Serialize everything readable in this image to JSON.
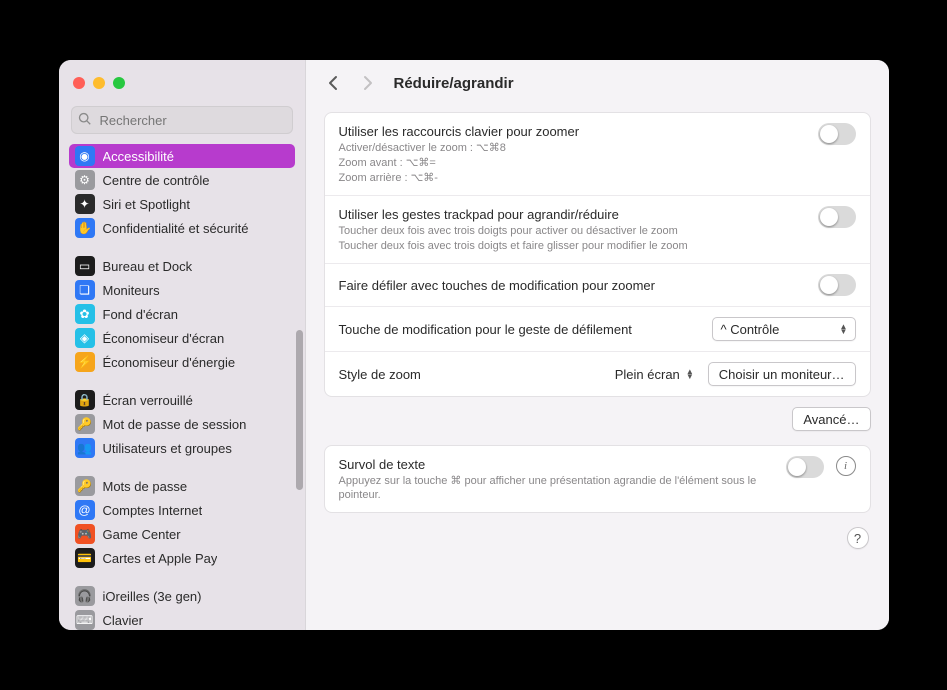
{
  "search": {
    "placeholder": "Rechercher"
  },
  "sidebar": {
    "items": [
      {
        "label": "Accessibilité",
        "color": "#2f78f5",
        "glyph": "◉"
      },
      {
        "label": "Centre de contrôle",
        "color": "#9a9a9e",
        "glyph": "⚙"
      },
      {
        "label": "Siri et Spotlight",
        "color": "#2a2a2a",
        "glyph": "✦"
      },
      {
        "label": "Confidentialité et sécurité",
        "color": "#2f78f5",
        "glyph": "✋"
      },
      {
        "label": "Bureau et Dock",
        "color": "#1c1c1c",
        "glyph": "▭"
      },
      {
        "label": "Moniteurs",
        "color": "#2f78f5",
        "glyph": "❏"
      },
      {
        "label": "Fond d'écran",
        "color": "#25c0e7",
        "glyph": "✿"
      },
      {
        "label": "Économiseur d'écran",
        "color": "#25c0e7",
        "glyph": "◈"
      },
      {
        "label": "Économiseur d'énergie",
        "color": "#f6a51b",
        "glyph": "⚡"
      },
      {
        "label": "Écran verrouillé",
        "color": "#1c1c1c",
        "glyph": "🔒"
      },
      {
        "label": "Mot de passe de session",
        "color": "#9a9a9e",
        "glyph": "🔑"
      },
      {
        "label": "Utilisateurs et groupes",
        "color": "#2f78f5",
        "glyph": "👥"
      },
      {
        "label": "Mots de passe",
        "color": "#9a9a9e",
        "glyph": "🔑"
      },
      {
        "label": "Comptes Internet",
        "color": "#2f78f5",
        "glyph": "@"
      },
      {
        "label": "Game Center",
        "color": "#f05123",
        "glyph": "🎮"
      },
      {
        "label": "Cartes et Apple Pay",
        "color": "#1c1c1c",
        "glyph": "💳"
      },
      {
        "label": "iOreilles (3e gen)",
        "color": "#9a9a9e",
        "glyph": "🎧"
      },
      {
        "label": "Clavier",
        "color": "#9a9a9e",
        "glyph": "⌨"
      }
    ],
    "groups": [
      [
        0,
        1,
        2,
        3
      ],
      [
        4,
        5,
        6,
        7,
        8
      ],
      [
        9,
        10,
        11
      ],
      [
        12,
        13,
        14,
        15
      ],
      [
        16,
        17
      ]
    ],
    "active_index": 0
  },
  "page": {
    "title": "Réduire/agrandir",
    "rows": {
      "kb": {
        "title": "Utiliser les raccourcis clavier pour zoomer",
        "l1": "Activer/désactiver le zoom : ⌥⌘8",
        "l2": "Zoom avant : ⌥⌘=",
        "l3": "Zoom arrière : ⌥⌘-"
      },
      "trackpad": {
        "title": "Utiliser les gestes trackpad pour agrandir/réduire",
        "l1": "Toucher deux fois avec trois doigts pour activer ou désactiver le zoom",
        "l2": "Toucher deux fois avec trois doigts et faire glisser pour modifier le zoom"
      },
      "scroll": {
        "title": "Faire défiler avec touches de modification pour zoomer"
      },
      "mod": {
        "title": "Touche de modification pour le geste de défilement",
        "value": "^ Contrôle"
      },
      "style": {
        "title": "Style de zoom",
        "value": "Plein écran",
        "button": "Choisir un moniteur…"
      },
      "advanced_button": "Avancé…",
      "hover": {
        "title": "Survol de texte",
        "sub": "Appuyez sur la touche ⌘ pour afficher une présentation agrandie de l'élément sous le pointeur."
      }
    },
    "help": "?"
  }
}
